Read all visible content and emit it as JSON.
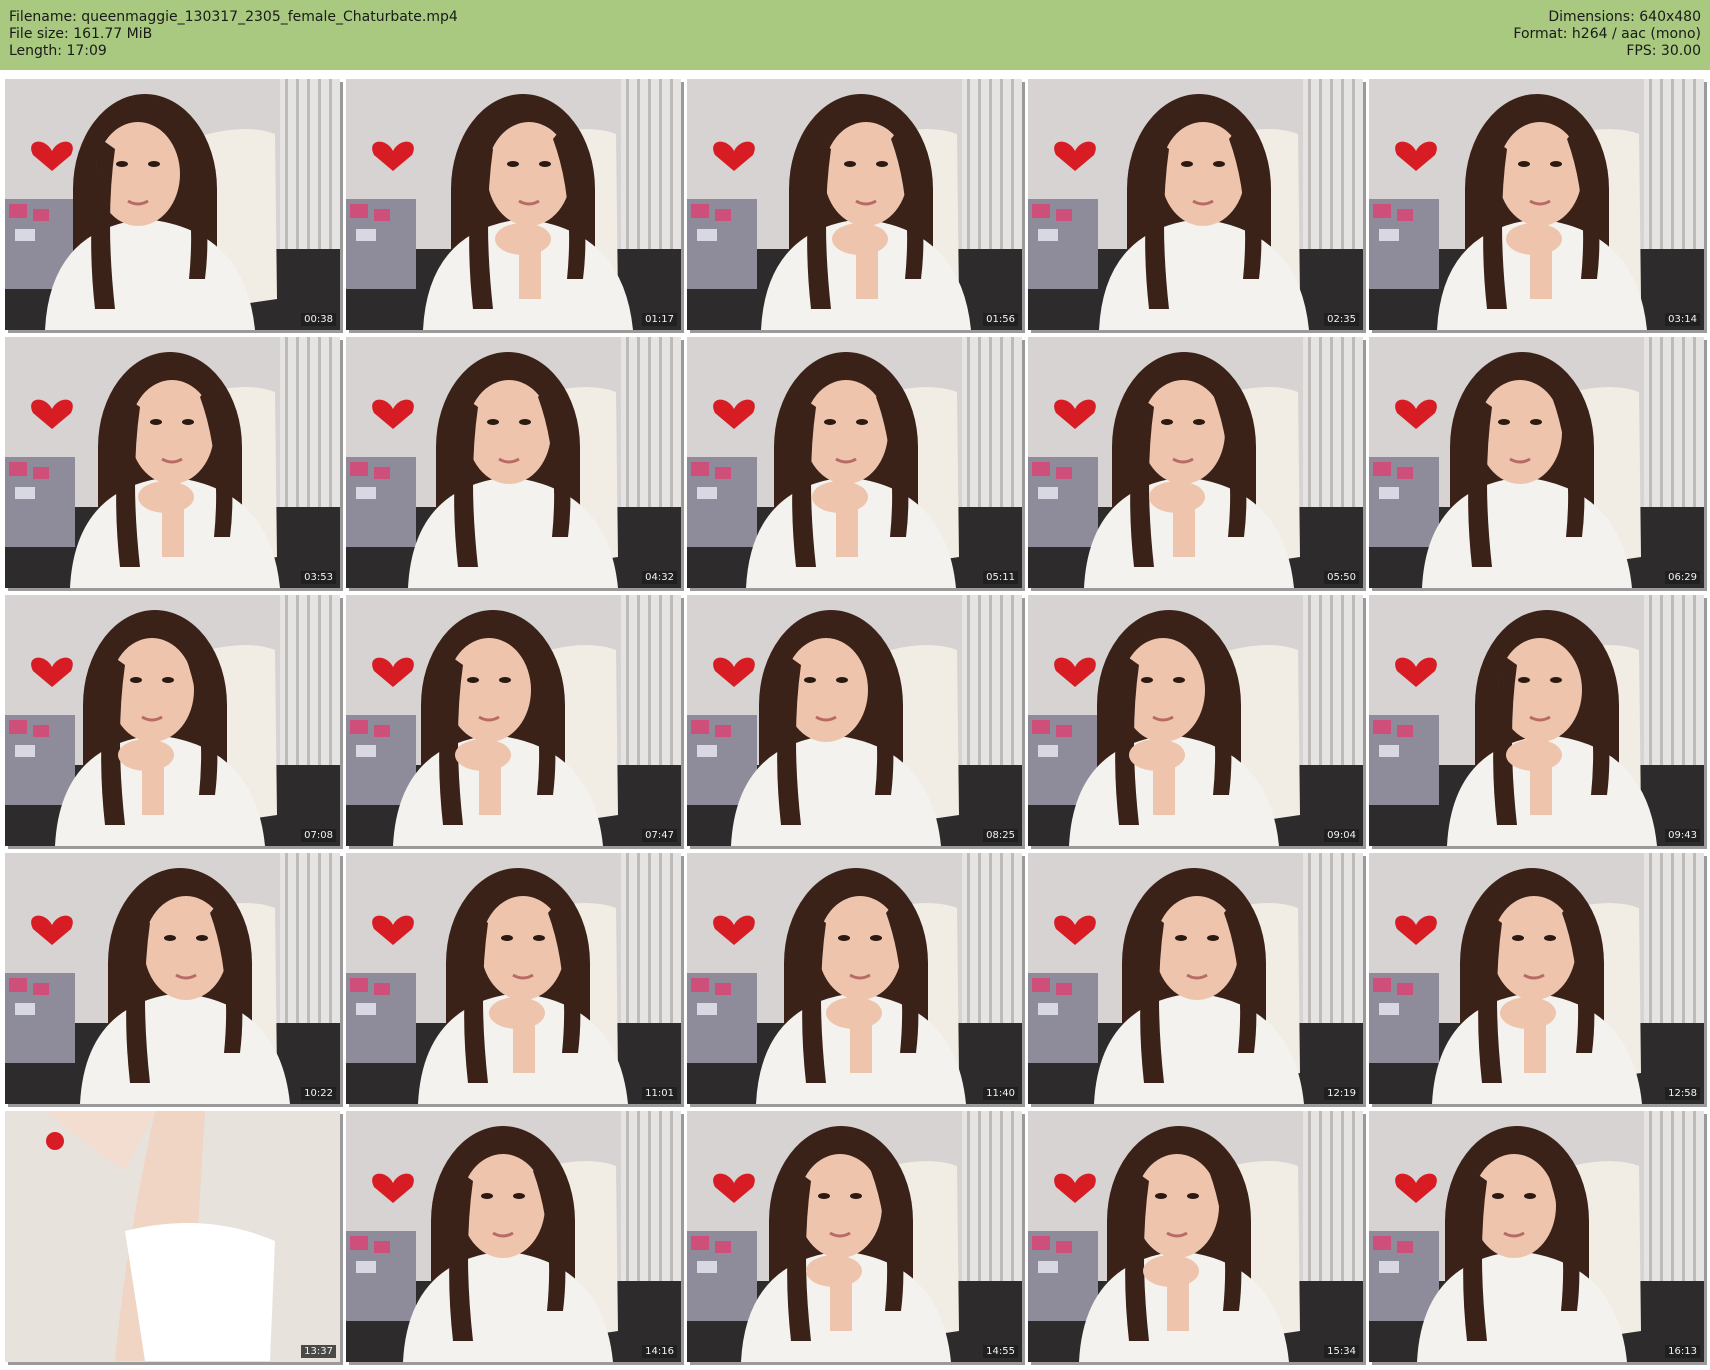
{
  "meta": {
    "left": [
      "Filename: queenmaggie_130317_2305_female_Chaturbate.mp4",
      "File size: 161.77 MiB",
      "Length: 17:09"
    ],
    "right": [
      "Dimensions: 640x480",
      "Format: h264 / aac (mono)",
      "FPS: 30.00"
    ]
  },
  "colors": {
    "header_bg": "#a8c97f",
    "heart": "#d81c24",
    "wall": "#d6d3d2",
    "pillow": "#f1ece4",
    "sweater": "#f4f2ee",
    "hair": "#3b2218",
    "skin": "#eec4ad"
  },
  "thumbnails": [
    {
      "timestamp": "00:38"
    },
    {
      "timestamp": "01:17"
    },
    {
      "timestamp": "01:56"
    },
    {
      "timestamp": "02:35"
    },
    {
      "timestamp": "03:14"
    },
    {
      "timestamp": "03:53"
    },
    {
      "timestamp": "04:32"
    },
    {
      "timestamp": "05:11"
    },
    {
      "timestamp": "05:50"
    },
    {
      "timestamp": "06:29"
    },
    {
      "timestamp": "07:08"
    },
    {
      "timestamp": "07:47"
    },
    {
      "timestamp": "08:25"
    },
    {
      "timestamp": "09:04"
    },
    {
      "timestamp": "09:43"
    },
    {
      "timestamp": "10:22"
    },
    {
      "timestamp": "11:01"
    },
    {
      "timestamp": "11:40"
    },
    {
      "timestamp": "12:19"
    },
    {
      "timestamp": "12:58"
    },
    {
      "timestamp": "13:37"
    },
    {
      "timestamp": "14:16"
    },
    {
      "timestamp": "14:55"
    },
    {
      "timestamp": "15:34"
    },
    {
      "timestamp": "16:13"
    }
  ]
}
